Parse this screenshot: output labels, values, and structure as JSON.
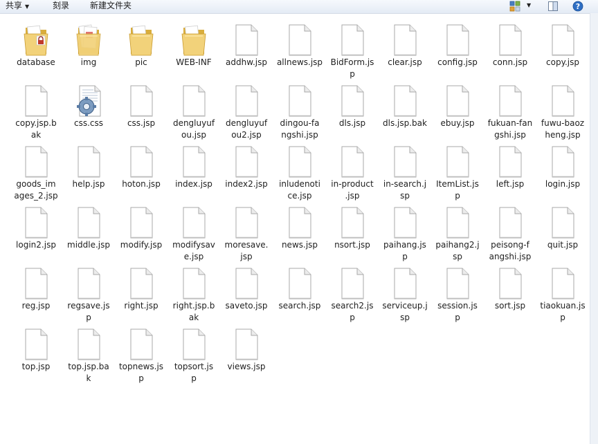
{
  "toolbar": {
    "share_label": "共享",
    "burn_label": "刻录",
    "new_folder_label": "新建文件夹"
  },
  "items": [
    {
      "label": "database",
      "icon": "folder-lock"
    },
    {
      "label": "img",
      "icon": "folder-docs"
    },
    {
      "label": "pic",
      "icon": "folder"
    },
    {
      "label": "WEB-INF",
      "icon": "folder"
    },
    {
      "label": "addhw.jsp",
      "icon": "file"
    },
    {
      "label": "allnews.jsp",
      "icon": "file"
    },
    {
      "label": "BidForm.js\np",
      "icon": "file"
    },
    {
      "label": "clear.jsp",
      "icon": "file"
    },
    {
      "label": "config.jsp",
      "icon": "file"
    },
    {
      "label": "conn.jsp",
      "icon": "file"
    },
    {
      "label": "copy.jsp",
      "icon": "file"
    },
    {
      "label": "copy.jsp.b\nak",
      "icon": "file"
    },
    {
      "label": "css.css",
      "icon": "css"
    },
    {
      "label": "css.jsp",
      "icon": "file"
    },
    {
      "label": "dengluyuf\nou.jsp",
      "icon": "file"
    },
    {
      "label": "dengluyuf\nou2.jsp",
      "icon": "file"
    },
    {
      "label": "dingou-fa\nngshi.jsp",
      "icon": "file"
    },
    {
      "label": "dls.jsp",
      "icon": "file"
    },
    {
      "label": "dls.jsp.bak",
      "icon": "file"
    },
    {
      "label": "ebuy.jsp",
      "icon": "file"
    },
    {
      "label": "fukuan-fan\ngshi.jsp",
      "icon": "file"
    },
    {
      "label": "fuwu-baoz\nheng.jsp",
      "icon": "file"
    },
    {
      "label": "goods_im\nages_2.jsp",
      "icon": "file"
    },
    {
      "label": "help.jsp",
      "icon": "file"
    },
    {
      "label": "hoton.jsp",
      "icon": "file"
    },
    {
      "label": "index.jsp",
      "icon": "file"
    },
    {
      "label": "index2.jsp",
      "icon": "file"
    },
    {
      "label": "inludenoti\nce.jsp",
      "icon": "file"
    },
    {
      "label": "in-product\n.jsp",
      "icon": "file"
    },
    {
      "label": "in-search.j\nsp",
      "icon": "file"
    },
    {
      "label": "ItemList.js\np",
      "icon": "file"
    },
    {
      "label": "left.jsp",
      "icon": "file"
    },
    {
      "label": "login.jsp",
      "icon": "file"
    },
    {
      "label": "login2.jsp",
      "icon": "file"
    },
    {
      "label": "middle.jsp",
      "icon": "file"
    },
    {
      "label": "modify.jsp",
      "icon": "file"
    },
    {
      "label": "modifysav\ne.jsp",
      "icon": "file"
    },
    {
      "label": "moresave.\njsp",
      "icon": "file"
    },
    {
      "label": "news.jsp",
      "icon": "file"
    },
    {
      "label": "nsort.jsp",
      "icon": "file"
    },
    {
      "label": "paihang.js\np",
      "icon": "file"
    },
    {
      "label": "paihang2.j\nsp",
      "icon": "file"
    },
    {
      "label": "peisong-f\nangshi.jsp",
      "icon": "file"
    },
    {
      "label": "quit.jsp",
      "icon": "file"
    },
    {
      "label": "reg.jsp",
      "icon": "file"
    },
    {
      "label": "regsave.js\np",
      "icon": "file"
    },
    {
      "label": "right.jsp",
      "icon": "file"
    },
    {
      "label": "right.jsp.b\nak",
      "icon": "file"
    },
    {
      "label": "saveto.jsp",
      "icon": "file"
    },
    {
      "label": "search.jsp",
      "icon": "file"
    },
    {
      "label": "search2.js\np",
      "icon": "file"
    },
    {
      "label": "serviceup.j\nsp",
      "icon": "file"
    },
    {
      "label": "session.js\np",
      "icon": "file"
    },
    {
      "label": "sort.jsp",
      "icon": "file"
    },
    {
      "label": "tiaokuan.js\np",
      "icon": "file"
    },
    {
      "label": "top.jsp",
      "icon": "file"
    },
    {
      "label": "top.jsp.ba\nk",
      "icon": "file"
    },
    {
      "label": "topnews.js\np",
      "icon": "file"
    },
    {
      "label": "topsort.js\np",
      "icon": "file"
    },
    {
      "label": "views.jsp",
      "icon": "file"
    }
  ],
  "colors": {
    "folder": "#f2d27a",
    "folder_dark": "#d9ad3c",
    "text": "#1e1e1e",
    "toolbar_bg": "#e9eff7"
  }
}
